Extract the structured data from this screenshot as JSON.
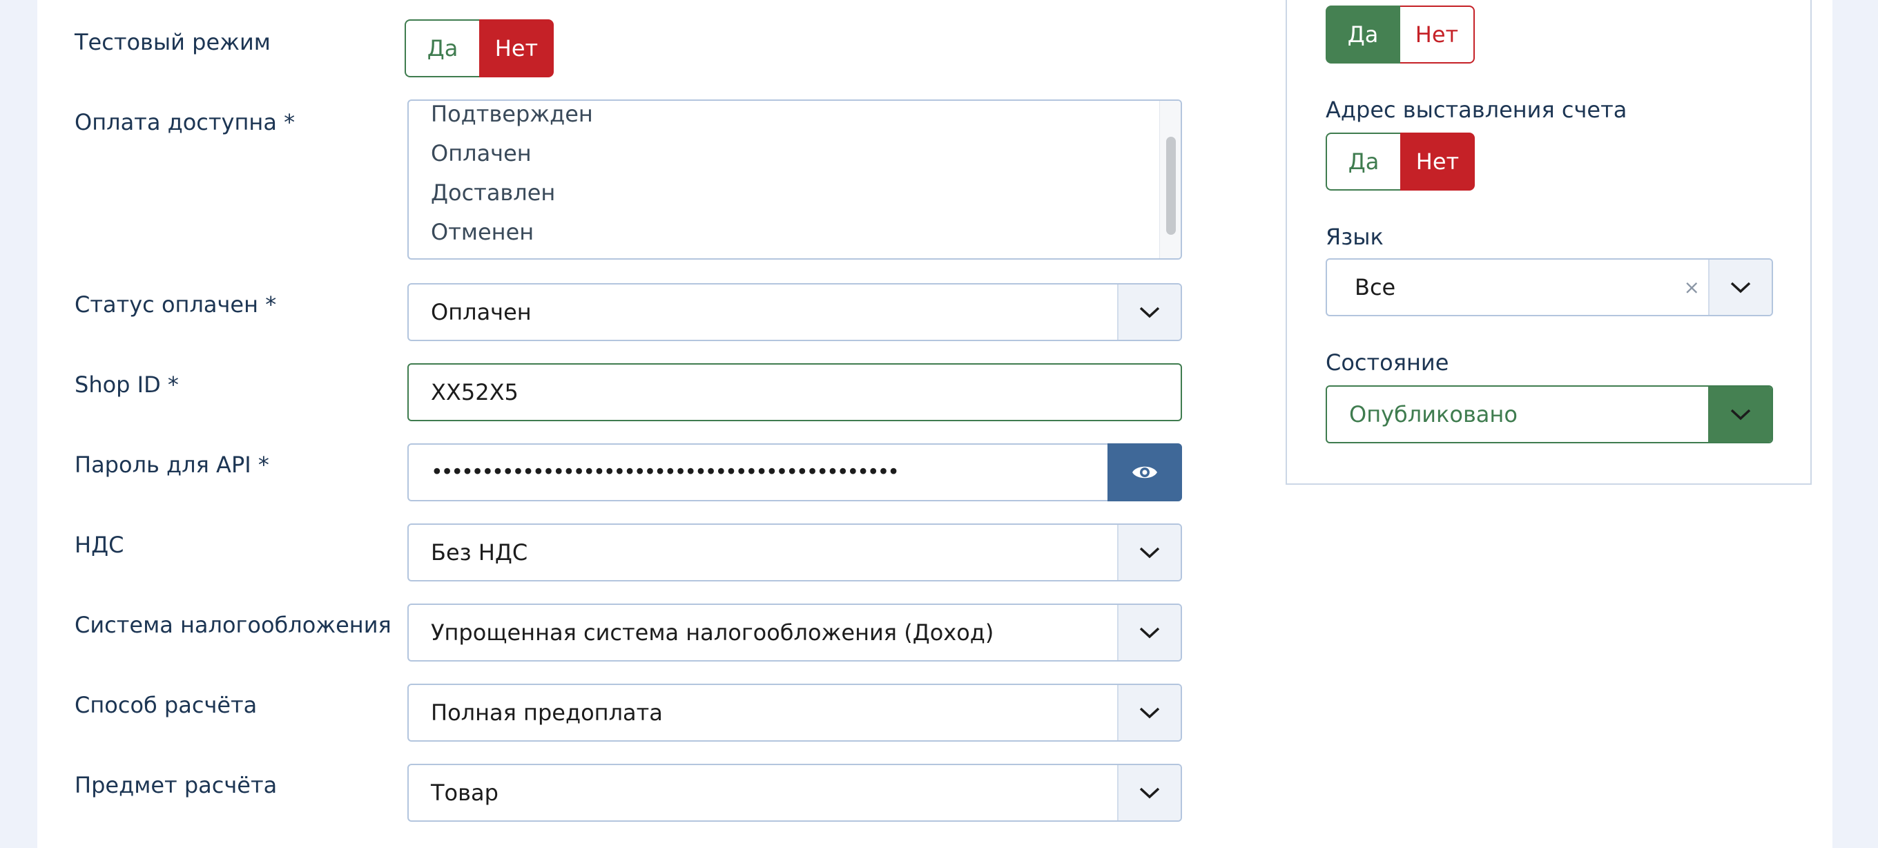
{
  "form": {
    "test_mode": {
      "label": "Тестовый режим",
      "yes": "Да",
      "no": "Нет",
      "selected": "Нет"
    },
    "payment_available": {
      "label": "Оплата доступна *",
      "options": [
        "Подтвержден",
        "Оплачен",
        "Доставлен",
        "Отменен"
      ]
    },
    "status_paid": {
      "label": "Статус оплачен *",
      "value": "Оплачен"
    },
    "shop_id": {
      "label": "Shop ID *",
      "value": "XX52X5"
    },
    "api_password": {
      "label": "Пароль для API *",
      "value": "••••••••••••••••••••••••••••••••••••••••••••••"
    },
    "vat": {
      "label": "НДС",
      "value": "Без НДС"
    },
    "tax_system": {
      "label": "Система налогообложения",
      "value": "Упрощенная система налогообложения (Доход)"
    },
    "calc_method": {
      "label": "Способ расчёта",
      "value": "Полная предоплата"
    },
    "calc_subject": {
      "label": "Предмет расчёта",
      "value": "Товар"
    }
  },
  "sidebar": {
    "top_toggle": {
      "yes": "Да",
      "no": "Нет",
      "selected": "Да"
    },
    "billing_address": {
      "label": "Адрес выставления счета",
      "yes": "Да",
      "no": "Нет",
      "selected": "Нет"
    },
    "language": {
      "label": "Язык",
      "value": "Все",
      "clear": "×"
    },
    "state": {
      "label": "Состояние",
      "value": "Опубликовано"
    }
  },
  "colors": {
    "green": "#458152",
    "red": "#c52127",
    "blue_button": "#3f6898",
    "page_bg": "#eef2fa"
  },
  "icons": {
    "caret": "chevron-down-icon",
    "reveal": "eye-icon",
    "clear": "close-icon"
  }
}
